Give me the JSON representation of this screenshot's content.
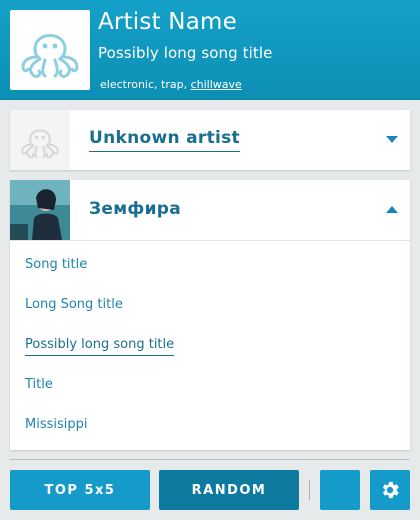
{
  "header": {
    "artist_name": "Artist Name",
    "song_title": "Possibly long song title",
    "tags": [
      "electronic",
      "trap",
      "chillwave"
    ],
    "tag_separator_1": ", ",
    "tag_separator_2": ", "
  },
  "artists": [
    {
      "name": "Unknown artist",
      "expanded": false
    },
    {
      "name": "Земфира",
      "expanded": true,
      "songs": [
        "Song title",
        "Long Song title",
        "Possibly long song title",
        "Title",
        "Missisippi"
      ],
      "active_song_index": 2
    }
  ],
  "footer": {
    "top_label": "TOP 5x5",
    "random_label": "RANDOM"
  },
  "colors": {
    "accent": "#159bc9",
    "accent_dark": "#0e7aa0",
    "link": "#1f84b0"
  }
}
